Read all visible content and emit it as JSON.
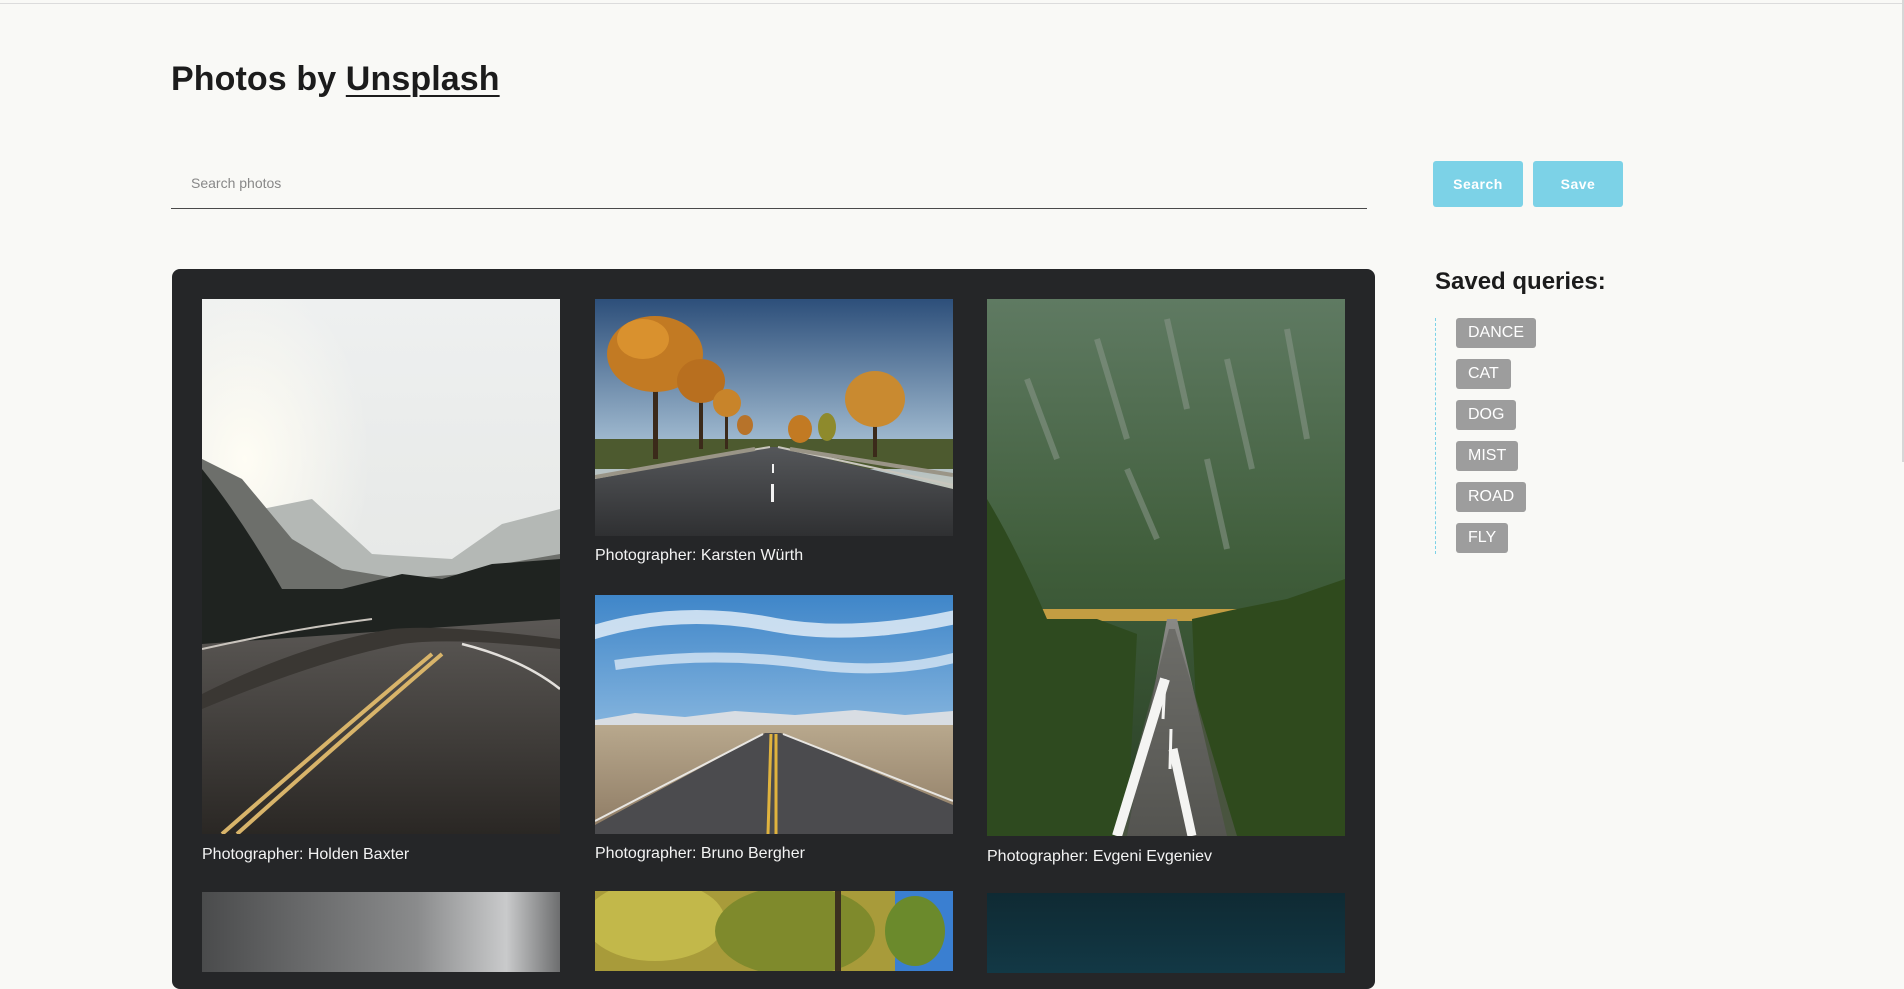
{
  "header": {
    "title_prefix": "Photos by ",
    "title_link": "Unsplash"
  },
  "search": {
    "placeholder": "Search photos",
    "value": "",
    "search_label": "Search",
    "save_label": "Save"
  },
  "saved": {
    "title": "Saved queries:",
    "items": [
      "DANCE",
      "CAT",
      "DOG",
      "MIST",
      "ROAD",
      "FLY"
    ]
  },
  "photos": [
    {
      "caption": "Photographer: Holden Baxter"
    },
    {
      "caption": "Photographer: Karsten Würth"
    },
    {
      "caption": "Photographer: Bruno Bergher"
    },
    {
      "caption": "Photographer: Evgeni Evgeniev"
    }
  ],
  "colors": {
    "accent": "#7cd2e7",
    "tag": "#9d9d9d",
    "gallery_bg": "#252628",
    "page_bg": "#f9f9f6"
  }
}
